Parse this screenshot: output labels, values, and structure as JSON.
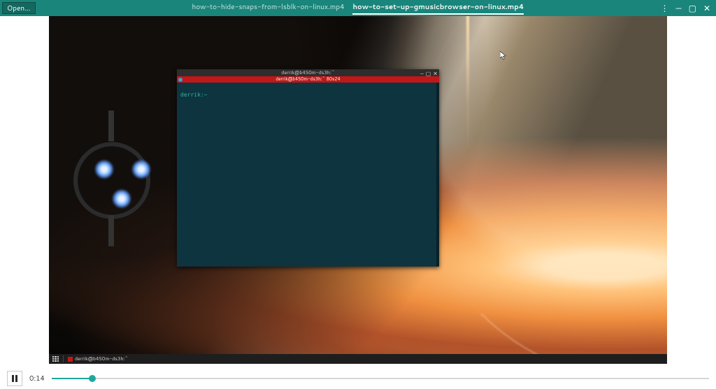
{
  "header": {
    "open_label": "Open…",
    "tabs": [
      {
        "label": "how-to-hide-snaps-from-lsblk-on-linux.mp4",
        "active": false
      },
      {
        "label": "how-to-set-up-gmusicbrowser-on-linux.mp4",
        "active": true
      }
    ]
  },
  "terminal": {
    "title": "derrik@b450m-ds3h:~",
    "redbar_label": "derrik@b450m-ds3h:~ 80x24",
    "prompt": "derrik:~"
  },
  "taskbar": {
    "item_label": "derrik@b450m-ds3h:~"
  },
  "player": {
    "time_elapsed": "0:14",
    "progress_pct": 6.2
  }
}
